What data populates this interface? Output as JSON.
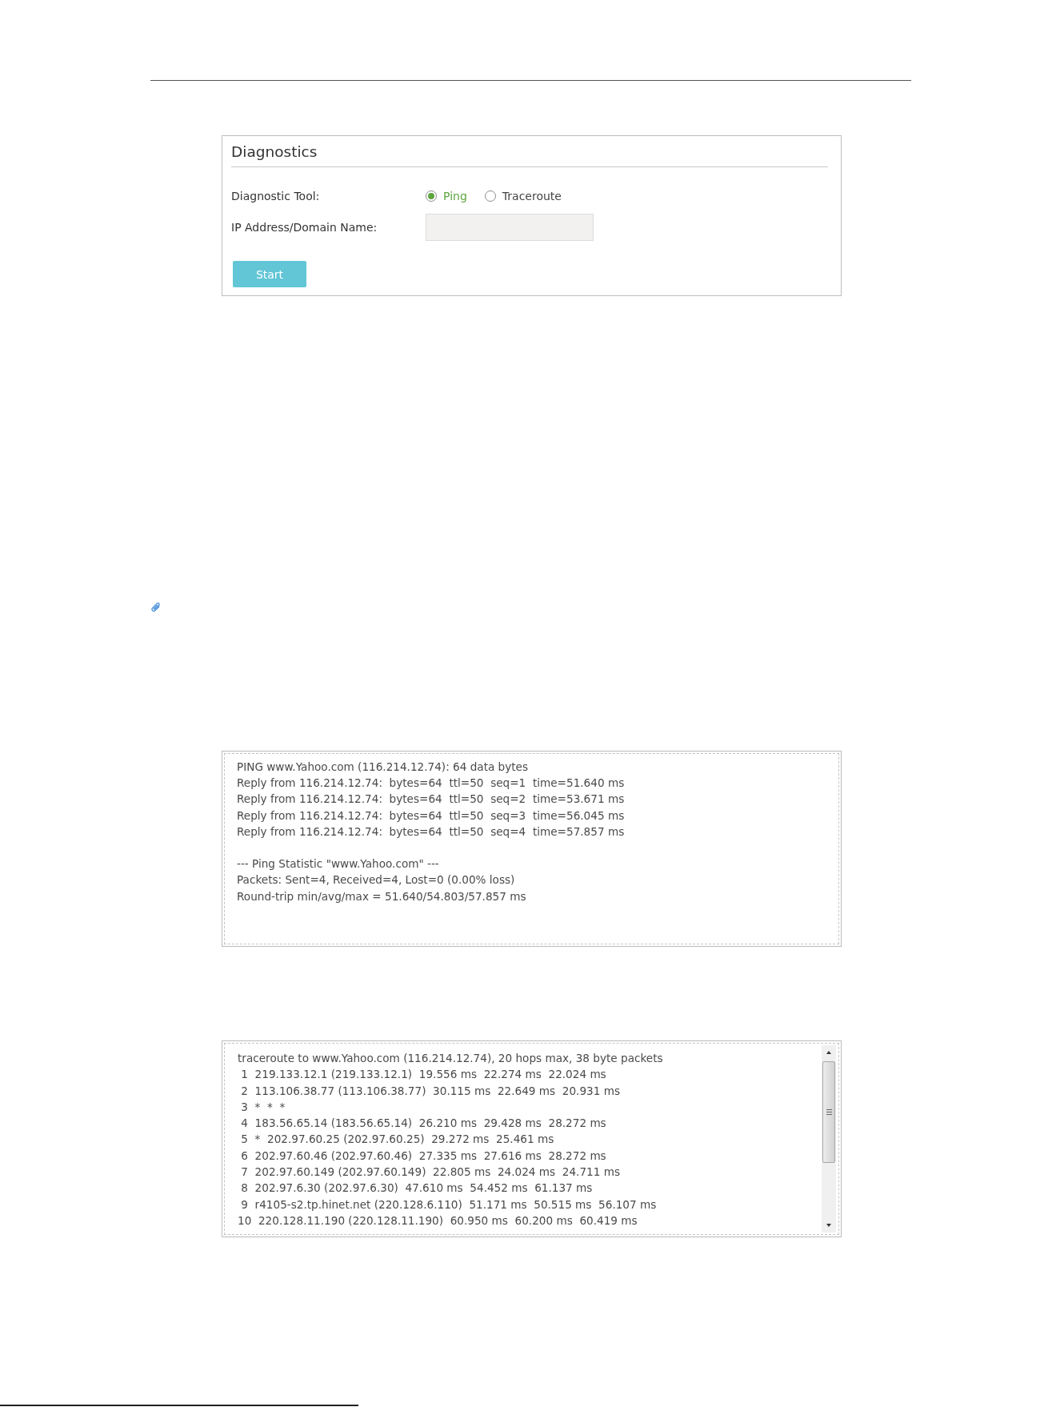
{
  "diagnostics": {
    "title": "Diagnostics",
    "tool": {
      "label": "Diagnostic Tool:",
      "options": [
        {
          "label": "Ping",
          "selected": true
        },
        {
          "label": "Traceroute",
          "selected": false
        }
      ]
    },
    "address": {
      "label": "IP Address/Domain Name:"
    },
    "start_button": "Start"
  },
  "ping_output": {
    "header": "PING www.Yahoo.com (116.214.12.74): 64 data bytes",
    "replies": [
      "Reply from 116.214.12.74:  bytes=64  ttl=50  seq=1  time=51.640 ms",
      "Reply from 116.214.12.74:  bytes=64  ttl=50  seq=2  time=53.671 ms",
      "Reply from 116.214.12.74:  bytes=64  ttl=50  seq=3  time=56.045 ms",
      "Reply from 116.214.12.74:  bytes=64  ttl=50  seq=4  time=57.857 ms"
    ],
    "statistics": [
      "--- Ping Statistic \"www.Yahoo.com\" ---",
      "Packets: Sent=4, Received=4, Lost=0 (0.00% loss)",
      "Round-trip min/avg/max = 51.640/54.803/57.857 ms"
    ]
  },
  "traceroute_output": {
    "header": "traceroute to www.Yahoo.com (116.214.12.74), 20 hops max, 38 byte packets",
    "hops": [
      " 1  219.133.12.1 (219.133.12.1)  19.556 ms  22.274 ms  22.024 ms",
      " 2  113.106.38.77 (113.106.38.77)  30.115 ms  22.649 ms  20.931 ms",
      " 3  *  *  *",
      " 4  183.56.65.14 (183.56.65.14)  26.210 ms  29.428 ms  28.272 ms",
      " 5  *  202.97.60.25 (202.97.60.25)  29.272 ms  25.461 ms",
      " 6  202.97.60.46 (202.97.60.46)  27.335 ms  27.616 ms  28.272 ms",
      " 7  202.97.60.149 (202.97.60.149)  22.805 ms  24.024 ms  24.711 ms",
      " 8  202.97.6.30 (202.97.6.30)  47.610 ms  54.452 ms  61.137 ms",
      " 9  r4105-s2.tp.hinet.net (220.128.6.110)  51.171 ms  50.515 ms  56.107 ms",
      "10  220.128.11.190 (220.128.11.190)  60.950 ms  60.200 ms  60.419 ms"
    ]
  }
}
